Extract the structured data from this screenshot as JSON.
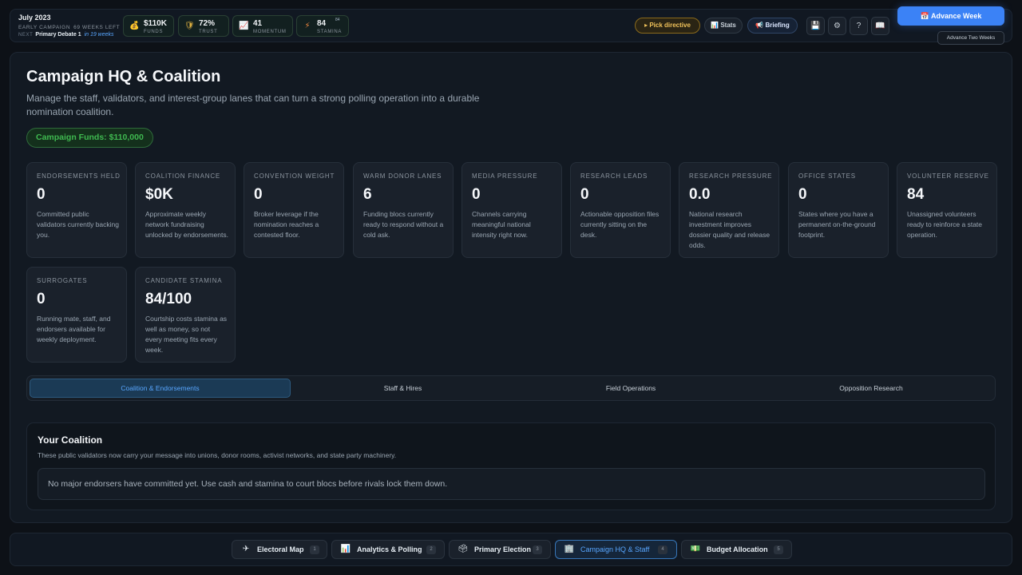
{
  "header": {
    "month": "July 2023",
    "phase": "EARLY CAMPAIGN",
    "weeks_left": "69 WEEKS LEFT",
    "next_label": "NEXT",
    "next_event": "Primary Debate 1",
    "next_in": "in 19 weeks",
    "stats": [
      {
        "icon": "money-bag-icon",
        "value": "$110K",
        "label": "FUNDS",
        "color": "#d29922"
      },
      {
        "icon": "shield-icon",
        "value": "72%",
        "label": "TRUST",
        "color": "#e3b341"
      },
      {
        "icon": "trend-chart-icon",
        "value": "41",
        "label": "MOMENTUM",
        "color": "#8ab4f8"
      },
      {
        "icon": "lightning-icon",
        "value": "84",
        "label": "STAMINA",
        "mini": "84",
        "color": "#f0883e"
      }
    ],
    "pick_directive": "Pick directive",
    "stats_button": "Stats",
    "briefing_button": "Briefing",
    "advance_week": "Advance Week",
    "advance_two_weeks": "Advance Two Weeks"
  },
  "main": {
    "title": "Campaign HQ & Coalition",
    "description": "Manage the staff, validators, and interest-group lanes that can turn a strong polling operation into a durable nomination coalition.",
    "funds_badge": "Campaign Funds: $110,000",
    "cards": [
      {
        "label": "ENDORSEMENTS HELD",
        "value": "0",
        "desc": "Committed public validators currently backing you."
      },
      {
        "label": "COALITION FINANCE",
        "value": "$0K",
        "desc": "Approximate weekly network fundraising unlocked by endorsements."
      },
      {
        "label": "CONVENTION WEIGHT",
        "value": "0",
        "desc": "Broker leverage if the nomination reaches a contested floor."
      },
      {
        "label": "WARM DONOR LANES",
        "value": "6",
        "desc": "Funding blocs currently ready to respond without a cold ask."
      },
      {
        "label": "MEDIA PRESSURE",
        "value": "0",
        "desc": "Channels carrying meaningful national intensity right now."
      },
      {
        "label": "RESEARCH LEADS",
        "value": "0",
        "desc": "Actionable opposition files currently sitting on the desk."
      },
      {
        "label": "RESEARCH PRESSURE",
        "value": "0.0",
        "desc": "National research investment improves dossier quality and release odds."
      },
      {
        "label": "OFFICE STATES",
        "value": "0",
        "desc": "States where you have a permanent on-the-ground footprint."
      },
      {
        "label": "VOLUNTEER RESERVE",
        "value": "84",
        "desc": "Unassigned volunteers ready to reinforce a state operation."
      },
      {
        "label": "SURROGATES",
        "value": "0",
        "desc": "Running mate, staff, and endorsers available for weekly deployment."
      },
      {
        "label": "CANDIDATE STAMINA",
        "value": "84/100",
        "desc": "Courtship costs stamina as well as money, so not every meeting fits every week."
      }
    ],
    "tabs": [
      "Coalition & Endorsements",
      "Staff & Hires",
      "Field Operations",
      "Opposition Research"
    ],
    "coalition": {
      "title": "Your Coalition",
      "description": "These public validators now carry your message into unions, donor rooms, activist networks, and state party machinery.",
      "empty_message": "No major endorsers have committed yet. Use cash and stamina to court blocs before rivals lock them down."
    }
  },
  "bottom_nav": [
    {
      "icon": "airplane-icon",
      "label": "Electoral Map",
      "key": "1"
    },
    {
      "icon": "bar-chart-icon",
      "label": "Analytics & Polling",
      "key": "2"
    },
    {
      "icon": "ballot-box-icon",
      "label": "Primary Election",
      "key": "3"
    },
    {
      "icon": "building-icon",
      "label": "Campaign HQ & Staff",
      "key": "4"
    },
    {
      "icon": "cash-icon",
      "label": "Budget Allocation",
      "key": "5"
    }
  ]
}
